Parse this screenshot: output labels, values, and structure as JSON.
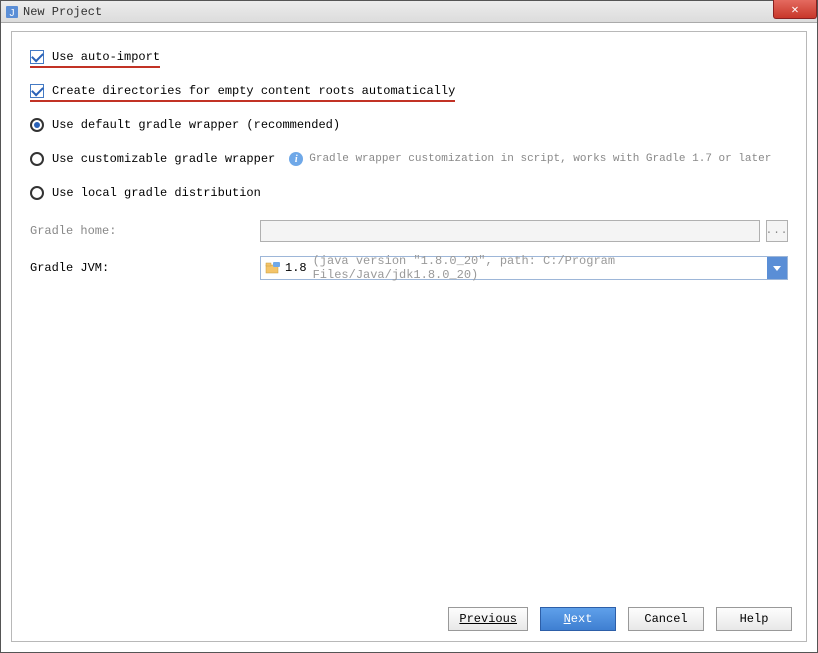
{
  "window": {
    "title": "New Project"
  },
  "checkboxes": {
    "auto_import": {
      "label": "Use auto-import",
      "checked": true
    },
    "create_dirs": {
      "label": "Create directories for empty content roots automatically",
      "checked": true
    }
  },
  "radios": {
    "default_wrapper": {
      "label": "Use default gradle wrapper (recommended)",
      "selected": true
    },
    "custom_wrapper": {
      "label": "Use customizable gradle wrapper",
      "selected": false,
      "info": "Gradle wrapper customization in script, works with Gradle 1.7 or later"
    },
    "local_dist": {
      "label": "Use local gradle distribution",
      "selected": false
    }
  },
  "form": {
    "gradle_home": {
      "label": "Gradle home:",
      "value": ""
    },
    "gradle_jvm": {
      "label": "Gradle JVM:",
      "value": "1.8",
      "extra": "(java version \"1.8.0_20\", path: C:/Program Files/Java/jdk1.8.0_20)"
    }
  },
  "buttons": {
    "previous": "Previous",
    "next_prefix": "N",
    "next_rest": "ext",
    "cancel": "Cancel",
    "help": "Help"
  },
  "icons": {
    "close": "✕",
    "info": "i",
    "browse": "..."
  }
}
